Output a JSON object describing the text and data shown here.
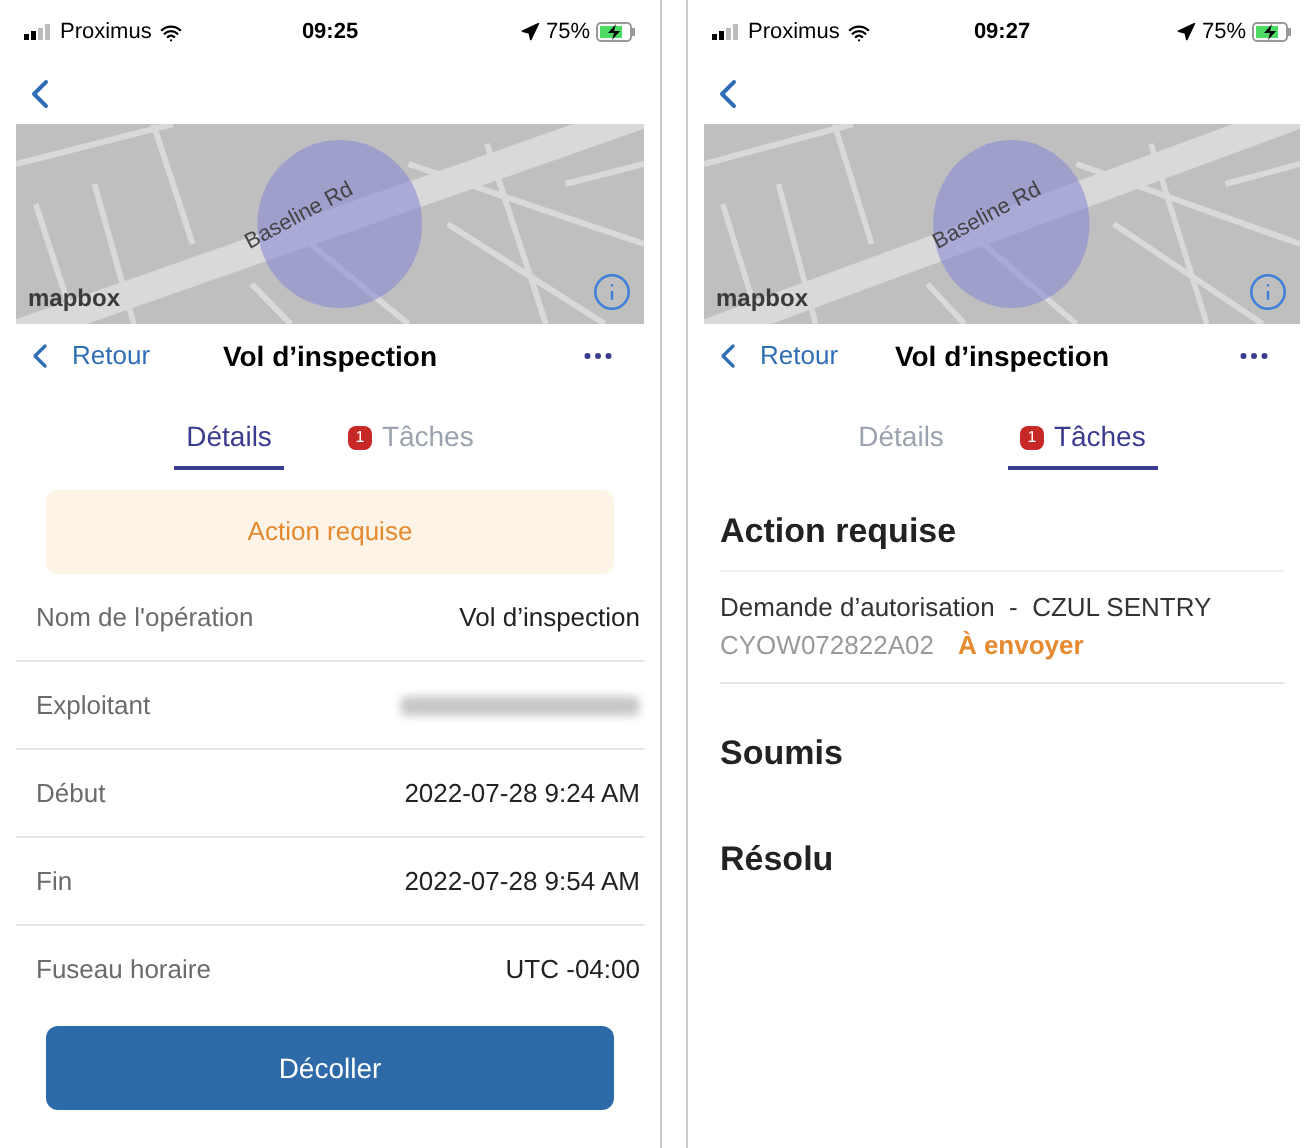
{
  "screens": [
    {
      "kind": "details",
      "status_bar": {
        "carrier": "Proximus",
        "time": "09:25",
        "battery": "75%"
      },
      "map": {
        "road_label": "Baseline Rd",
        "attribution": "mapbox"
      },
      "header": {
        "back": "Retour",
        "title": "Vol d’inspection"
      },
      "tabs": [
        {
          "label": "Détails",
          "selected": true
        },
        {
          "label": "Tâches",
          "selected": false,
          "badge": "1"
        }
      ],
      "banner": "Action requise",
      "rows": [
        {
          "label": "Nom de l'opération",
          "value": "Vol d’inspection",
          "redacted": false
        },
        {
          "label": "Exploitant",
          "redacted": true
        },
        {
          "label": "Début",
          "value": "2022-07-28 9:24 AM",
          "redacted": false
        },
        {
          "label": "Fin",
          "value": "2022-07-28 9:54 AM",
          "redacted": false
        },
        {
          "label": "Fuseau horaire",
          "value": "UTC -04:00",
          "redacted": false
        }
      ],
      "button": "Décoller"
    },
    {
      "kind": "tasks",
      "status_bar": {
        "carrier": "Proximus",
        "time": "09:27",
        "battery": "75%"
      },
      "map": {
        "road_label": "Baseline Rd",
        "attribution": "mapbox"
      },
      "header": {
        "back": "Retour",
        "title": "Vol d’inspection"
      },
      "tabs": [
        {
          "label": "Détails",
          "selected": false
        },
        {
          "label": "Tâches",
          "selected": true,
          "badge": "1"
        }
      ],
      "sections": [
        {
          "title": "Action requise",
          "items": [
            {
              "title": "Demande d’autorisation  -  CZUL SENTRY",
              "code": "CYOW072822A02",
              "status": "À envoyer"
            }
          ]
        },
        {
          "title": "Soumis"
        },
        {
          "title": "Résolu"
        }
      ]
    }
  ]
}
